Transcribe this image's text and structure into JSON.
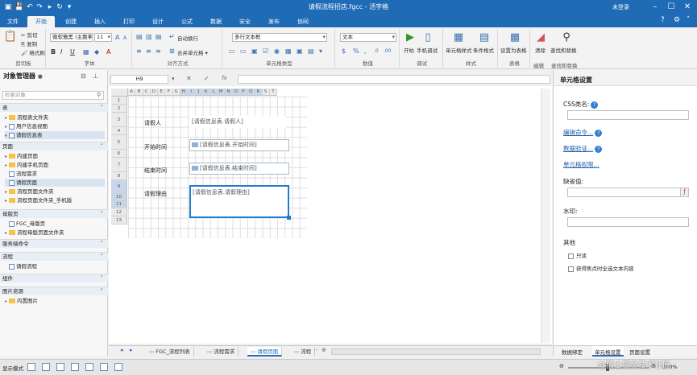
{
  "window": {
    "title": "请假流程招店.fgcc - 活字格",
    "user": "未登录"
  },
  "menu_tabs": [
    "文件",
    "开始",
    "创建",
    "插入",
    "打印",
    "设计",
    "公式",
    "数据",
    "安全",
    "发布",
    "协同"
  ],
  "ribbon": {
    "clipboard": {
      "cut": "剪切",
      "copy": "复制",
      "format_painter": "格式刷",
      "label": "剪切板"
    },
    "font": {
      "family": "微软雅黑 (主题字体)",
      "size": "11",
      "grow": "A",
      "shrink": "A",
      "bold": "B",
      "italic": "I",
      "underline": "U",
      "label": "字体"
    },
    "align": {
      "wrap": "自动换行",
      "merge": "合并单元格",
      "label": "对齐方式"
    },
    "celltype": {
      "type": "多行文本框",
      "label": "单元格类型"
    },
    "number": {
      "format": "文本",
      "currency": "$",
      "percent": "%",
      "label": "数值"
    },
    "debug": {
      "start": "开始",
      "mobile": "手机调试",
      "label": "调试"
    },
    "style": {
      "cell_style": "单元格样式",
      "cond_format": "条件格式",
      "label": "样式"
    },
    "table": {
      "set_table": "设置为表格",
      "label": "表格"
    },
    "edit": {
      "clear": "清除",
      "find": "查找和替换",
      "label": "编辑",
      "label2": "查找和替换"
    }
  },
  "left_panel": {
    "title": "对象管理器",
    "search_placeholder": "检索对象",
    "sections": [
      {
        "name": "表",
        "items": [
          "流程表文件夹",
          "用户信息视图",
          "请假信息表"
        ]
      },
      {
        "name": "页面",
        "items": [
          "内建页面",
          "内建手机页面",
          "流程需求",
          "请假页面",
          "流程页面文件夹",
          "流程页面文件夹_手机版"
        ]
      },
      {
        "name": "母版页",
        "items": [
          "FGC_母版页",
          "流程母版页面文件夹"
        ]
      },
      {
        "name": "服务端命令",
        "items": []
      },
      {
        "name": "流程",
        "items": [
          "请假流程"
        ]
      },
      {
        "name": "组件",
        "items": []
      },
      {
        "name": "图片资源",
        "items": [
          "内置图片"
        ]
      }
    ]
  },
  "formula_bar": {
    "cell_ref": "H9",
    "cancel": "✕",
    "confirm": "✓",
    "fx": "fx"
  },
  "grid": {
    "columns": [
      "A",
      "B",
      "C",
      "D",
      "E",
      "F",
      "G",
      "H",
      "I",
      "J",
      "K",
      "L",
      "M",
      "N",
      "O",
      "P",
      "Q",
      "R",
      "S",
      "T"
    ],
    "rows": [
      "1",
      "2",
      "3",
      "4",
      "5",
      "6",
      "7",
      "8",
      "9",
      "10",
      "11",
      "12",
      "13"
    ],
    "labels": {
      "applicant": "请假人",
      "start": "开始时间",
      "end": "结束时间",
      "reason": "请假理由"
    },
    "fields": {
      "applicant": "[请假信息表.请假人]",
      "start": "[请假信息表.开始时间]",
      "end": "[请假信息表.结束时间]",
      "reason": "[请假信息表.请假理由]"
    }
  },
  "sheet_tabs": [
    "FGC_流程列表",
    "流程需求",
    "请假页面",
    "流程"
  ],
  "right_panel": {
    "title": "单元格设置",
    "css_label": "CSS类名:",
    "edit_cmd": "编辑命令...",
    "validation": "数据验证...",
    "permission": "单元格权限...",
    "default_label": "缺省值:",
    "watermark_label": "水印:",
    "other_label": "其他",
    "readonly": "只读",
    "select_all": "获得焦点时全选文本内容",
    "bottom_tabs": [
      "数据绑定",
      "单元格设置",
      "页面设置"
    ]
  },
  "status": {
    "display_mode": "显示模式",
    "zoom": "100%"
  },
  "watermark_text": "@稀土掘金技术社区"
}
